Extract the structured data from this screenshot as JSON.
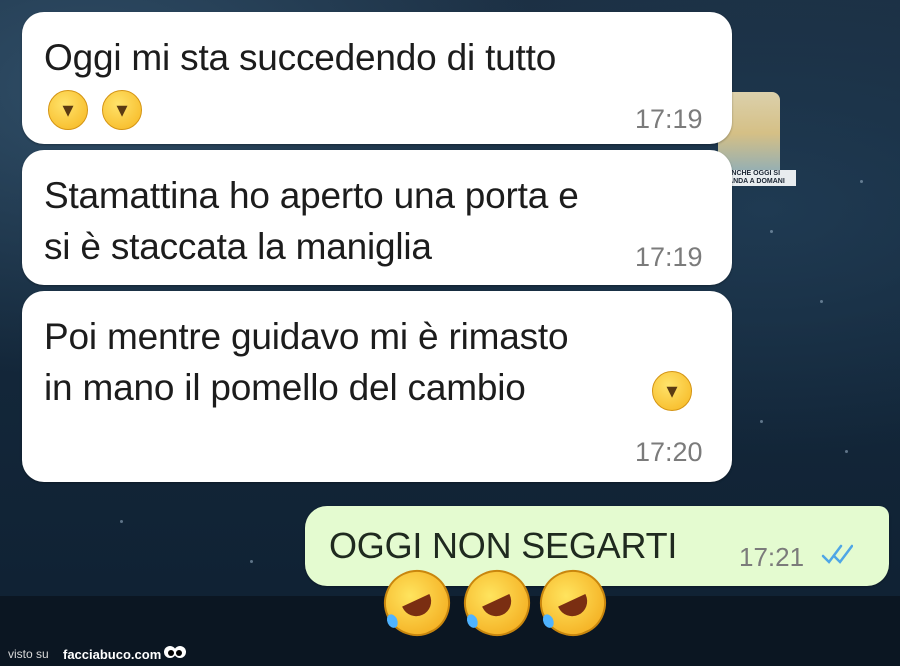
{
  "messages_in": [
    {
      "text": "Oggi mi sta succedendo di tutto",
      "time": "17:19"
    },
    {
      "text": "Stamattina ho aperto una porta e\nsi è staccata la maniglia",
      "time": "17:19"
    },
    {
      "text": "Poi mentre guidavo mi è rimasto\nin mano il pomello del cambio",
      "time": "17:20"
    }
  ],
  "message_out": {
    "text": "OGGI NON SEGARTI",
    "time": "17:21",
    "status_icon": "double-check-icon"
  },
  "sticker_caption": "E ANCHE OGGI SI RIMANDA A DOMANI",
  "footer": {
    "visto_su": "visto su",
    "site": "facciabuco.com",
    "logo_icon": "eyes-icon"
  },
  "colors": {
    "incoming_bubble": "#ffffff",
    "outgoing_bubble": "#e4fbd0",
    "read_ticks": "#4fa6e6"
  }
}
